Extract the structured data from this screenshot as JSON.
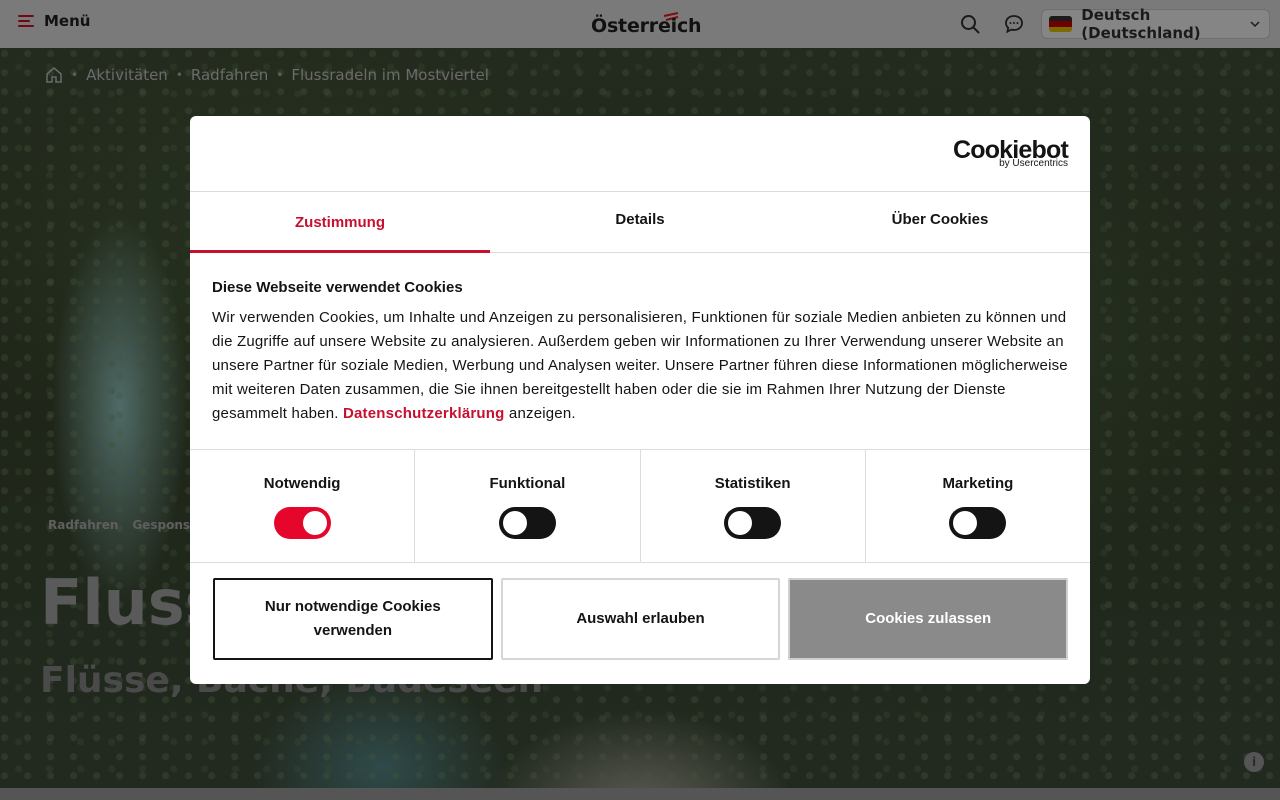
{
  "topbar": {
    "menu_label": "Menü",
    "logo_text": "Österreich",
    "language": "Deutsch (Deutschland)",
    "flag_colors": [
      "#000000",
      "#dd0000",
      "#ffce00"
    ]
  },
  "breadcrumb": {
    "items": [
      "Aktivitäten",
      "Radfahren",
      "Flussradeln im Mostviertel"
    ]
  },
  "hero": {
    "tags": [
      "Radfahren",
      "Gespons"
    ],
    "title": "Fluss",
    "subtitle": "Flüsse, Bäche, Badeseen",
    "info_label": "i"
  },
  "cookie_dialog": {
    "brand": "Cookiebot",
    "brand_sub": "by Usercentrics",
    "tabs": [
      "Zustimmung",
      "Details",
      "Über Cookies"
    ],
    "active_tab": "Zustimmung",
    "heading": "Diese Webseite verwendet Cookies",
    "text_before_link": "Wir verwenden Cookies, um Inhalte und Anzeigen zu personalisieren, Funktionen für soziale Medien anbieten zu können und die Zugriffe auf unsere Website zu analysieren. Außerdem geben wir Informationen zu Ihrer Verwendung unserer Website an unsere Partner für soziale Medien, Werbung und Analysen weiter. Unsere Partner führen diese Informationen möglicherweise mit weiteren Daten zusammen, die Sie ihnen bereitgestellt haben oder die sie im Rahmen Ihrer Nutzung der Dienste gesammelt haben.",
    "link_text": "Datenschutzerklärung",
    "text_after_link": "anzeigen.",
    "categories": [
      {
        "label": "Notwendig",
        "enabled": true
      },
      {
        "label": "Funktional",
        "enabled": false
      },
      {
        "label": "Statistiken",
        "enabled": false
      },
      {
        "label": "Marketing",
        "enabled": false
      }
    ],
    "buttons": {
      "necessary_only": "Nur notwendige Cookies verwenden",
      "allow_selection": "Auswahl erlauben",
      "allow_all": "Cookies zulassen"
    },
    "accent_color": "#c8102e",
    "toggle_on_color": "#e6052b"
  }
}
